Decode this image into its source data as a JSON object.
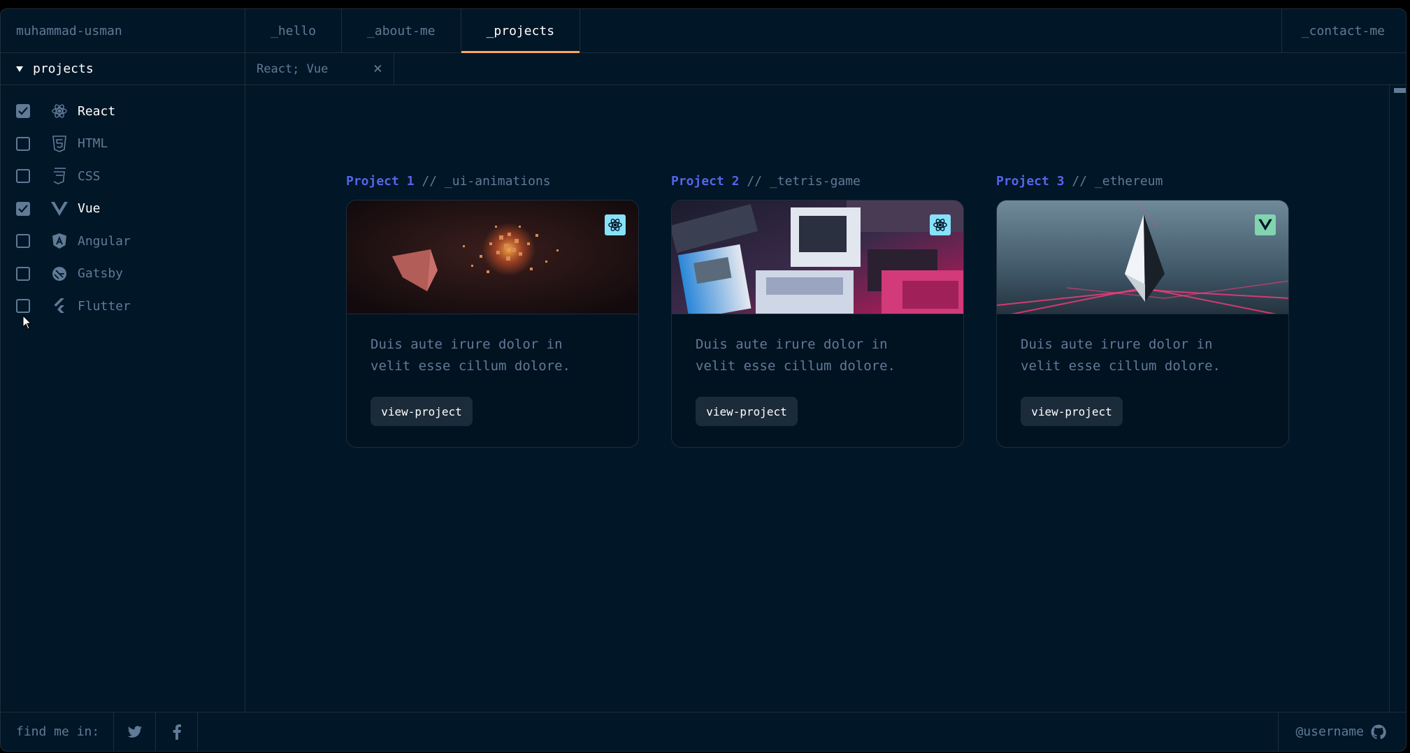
{
  "header": {
    "logo": "muhammad-usman",
    "tabs": [
      {
        "label": "_hello"
      },
      {
        "label": "_about-me"
      },
      {
        "label": "_projects"
      }
    ],
    "contact": "_contact-me"
  },
  "sidebar": {
    "section_title": "projects",
    "items": [
      {
        "label": "React",
        "checked": true,
        "icon": "react-icon"
      },
      {
        "label": "HTML",
        "checked": false,
        "icon": "html-icon"
      },
      {
        "label": "CSS",
        "checked": false,
        "icon": "css-icon"
      },
      {
        "label": "Vue",
        "checked": true,
        "icon": "vue-icon"
      },
      {
        "label": "Angular",
        "checked": false,
        "icon": "angular-icon"
      },
      {
        "label": "Gatsby",
        "checked": false,
        "icon": "gatsby-icon"
      },
      {
        "label": "Flutter",
        "checked": false,
        "icon": "flutter-icon"
      }
    ]
  },
  "editor": {
    "open_tab": "React; Vue",
    "close_glyph": "×"
  },
  "projects": [
    {
      "number": "Project 1",
      "slug": "// _ui-animations",
      "description": "Duis aute irure dolor in velit esse cillum dolore.",
      "button": "view-project",
      "badge": "react-icon"
    },
    {
      "number": "Project 2",
      "slug": "// _tetris-game",
      "description": "Duis aute irure dolor in velit esse cillum dolore.",
      "button": "view-project",
      "badge": "react-icon"
    },
    {
      "number": "Project 3",
      "slug": "// _ethereum",
      "description": "Duis aute irure dolor in velit esse cillum dolore.",
      "button": "view-project",
      "badge": "vue-icon"
    }
  ],
  "footer": {
    "find_me": "find me in:",
    "username": "@username"
  },
  "colors": {
    "background": "#011627",
    "border": "#1E2D3D",
    "text": "#607B96",
    "accent_orange": "#FEA55F",
    "accent_blue": "#5565E8"
  }
}
